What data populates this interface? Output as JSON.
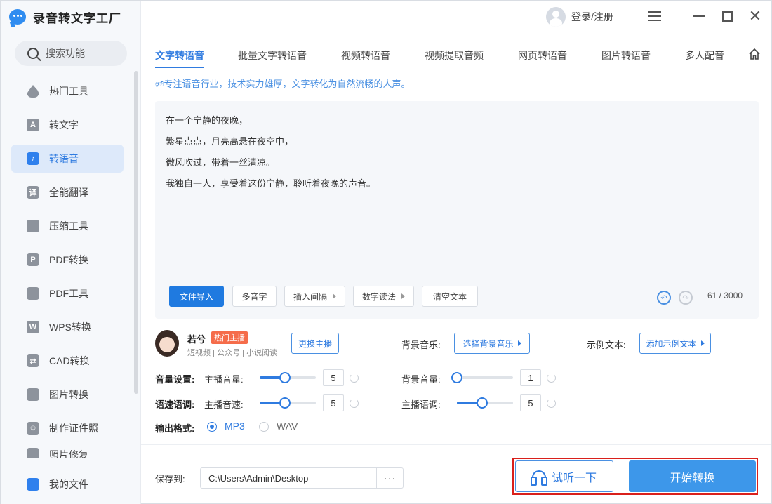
{
  "app": {
    "title": "录音转文字工厂"
  },
  "sidebar": {
    "search_label": "搜索功能",
    "items": [
      {
        "label": "热门工具"
      },
      {
        "label": "转文字"
      },
      {
        "label": "转语音"
      },
      {
        "label": "全能翻译"
      },
      {
        "label": "压缩工具"
      },
      {
        "label": "PDF转换"
      },
      {
        "label": "PDF工具"
      },
      {
        "label": "WPS转换"
      },
      {
        "label": "CAD转换"
      },
      {
        "label": "图片转换"
      },
      {
        "label": "制作证件照"
      },
      {
        "label": "照片修复"
      }
    ],
    "my_files": "我的文件"
  },
  "header": {
    "user_label": "登录/注册"
  },
  "tabs": [
    {
      "label": "文字转语音"
    },
    {
      "label": "批量文字转语音"
    },
    {
      "label": "视频转语音"
    },
    {
      "label": "视频提取音频"
    },
    {
      "label": "网页转语音"
    },
    {
      "label": "图片转语音"
    },
    {
      "label": "多人配音"
    }
  ],
  "slogan": "专注语音行业，技术实力雄厚，文字转化为自然流畅的人声。",
  "editor": {
    "lines": [
      "在一个宁静的夜晚，",
      "繁星点点，月亮高悬在夜空中，",
      "微风吹过，带着一丝清凉。",
      "我独自一人，享受着这份宁静，聆听着夜晚的声音。"
    ],
    "buttons": {
      "import": "文件导入",
      "polyphone": "多音字",
      "insert_pause": "插入间隔",
      "number_reading": "数字读法",
      "clear": "清空文本"
    },
    "char_count": "61 / 3000"
  },
  "anchor": {
    "name": "若兮",
    "badge": "热门主播",
    "tags": "短视频 | 公众号 | 小说阅读",
    "change_label": "更换主播"
  },
  "bg_music": {
    "label": "背景音乐:",
    "button": "选择背景音乐"
  },
  "sample_text": {
    "label": "示例文本:",
    "button": "添加示例文本"
  },
  "volume": {
    "label": "音量设置:",
    "anchor_volume_label": "主播音量:",
    "anchor_volume": "5",
    "anchor_volume_level": 0.45,
    "bg_volume_label": "背景音量:",
    "bg_volume": "1",
    "bg_volume_level": 0.0
  },
  "speed": {
    "label": "语速语调:",
    "anchor_speed_label": "主播音速:",
    "anchor_speed": "5",
    "anchor_speed_level": 0.45,
    "anchor_pitch_label": "主播语调:",
    "anchor_pitch": "5",
    "anchor_pitch_level": 0.45
  },
  "output": {
    "label": "输出格式:",
    "options": [
      "MP3",
      "WAV"
    ],
    "selected": "MP3"
  },
  "save": {
    "label": "保存到:",
    "path": "C:\\Users\\Admin\\Desktop",
    "more": "···"
  },
  "actions": {
    "listen": "试听一下",
    "start": "开始转换"
  },
  "colors": {
    "accent": "#2f7be0",
    "primary_button": "#3d97ea",
    "highlight": "#d9201c",
    "hot_badge": "#f56c4a"
  }
}
